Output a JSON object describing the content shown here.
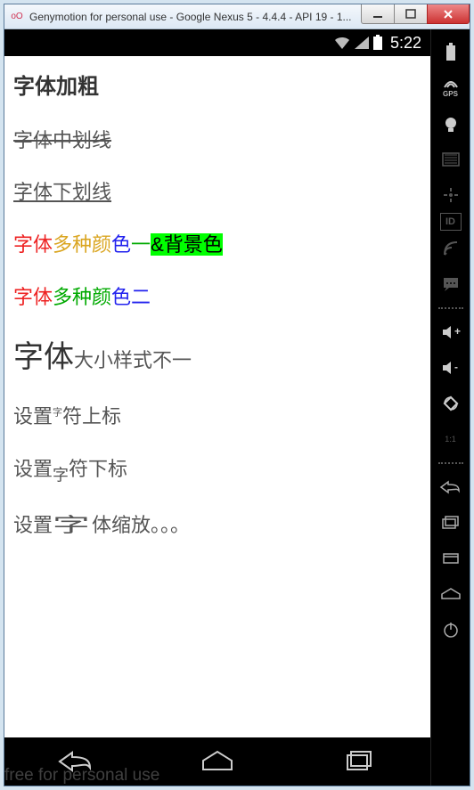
{
  "window": {
    "title": "Genymotion for personal use - Google Nexus 5 - 4.4.4 - API 19 - 1...",
    "icon_label": "oO"
  },
  "status_bar": {
    "clock": "5:22"
  },
  "rows": {
    "bold": "字体加粗",
    "strike": "字体中划线",
    "underline": "字体下划线",
    "multi1": {
      "a": "字体",
      "b": "多种颜",
      "c": "色",
      "d": "一",
      "e": "&背景色"
    },
    "multi2": {
      "a": "字体",
      "b": "多种颜",
      "c": "色",
      "d": "二"
    },
    "size": {
      "big": "字体",
      "rest": "大小样式不一"
    },
    "sup": {
      "pre": "设置",
      "sup": "字",
      "post": "符上标"
    },
    "sub": {
      "pre": "设置",
      "sub": "字",
      "post": "符下标"
    },
    "scale": {
      "pre": "设置",
      "scaled": "字",
      "post": "体缩放。。。"
    }
  },
  "watermark": "free for personal use",
  "toolbar": {
    "gps_label": "GPS",
    "id_label": "ID",
    "ratio": "1:1"
  }
}
